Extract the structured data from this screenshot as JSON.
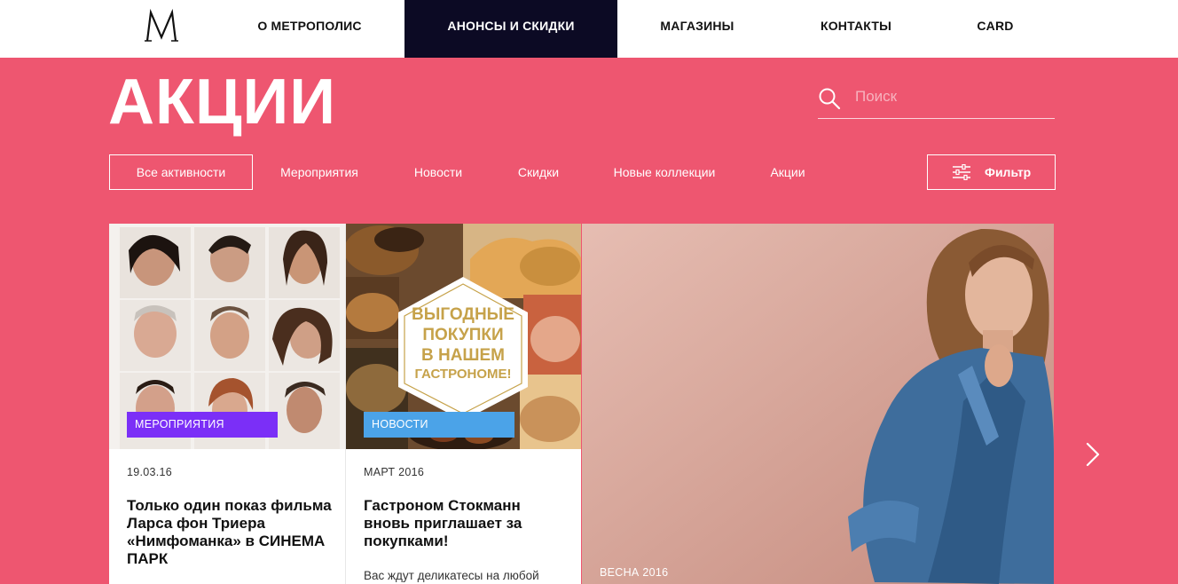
{
  "nav": {
    "items": [
      {
        "label": "О МЕТРОПОЛИС",
        "active": false
      },
      {
        "label": "АНОНСЫ И СКИДКИ",
        "active": true
      },
      {
        "label": "МАГАЗИНЫ",
        "active": false
      },
      {
        "label": "КОНТАКТЫ",
        "active": false
      },
      {
        "label": "CARD",
        "active": false
      }
    ]
  },
  "header": {
    "title": "АКЦИИ",
    "search_placeholder": "Поиск"
  },
  "tabs": [
    {
      "label": "Все активности",
      "selected": true
    },
    {
      "label": "Мероприятия",
      "selected": false
    },
    {
      "label": "Новости",
      "selected": false
    },
    {
      "label": "Скидки",
      "selected": false
    },
    {
      "label": "Новые коллекции",
      "selected": false
    },
    {
      "label": "Акции",
      "selected": false
    }
  ],
  "filter_label": "Фильтр",
  "cards": [
    {
      "badge": "МЕРОПРИЯТИЯ",
      "badge_color": "#7b2ff7",
      "date": "19.03.16",
      "title": "Только один показ фильма Ларса фон Триера «Нимфоманка» в СИНЕМА ПАРК",
      "description": ""
    },
    {
      "badge": "НОВОСТИ",
      "badge_color": "#4ba3e8",
      "date": "МАРТ 2016",
      "title": "Гастроном Стокманн вновь приглашает за покупками!",
      "description": "Вас ждут деликатесы на любой",
      "image_text": [
        "ВЫГОДНЫЕ",
        "ПОКУПКИ",
        "В НАШЕМ",
        "ГАСТРОНОМЕ!"
      ]
    }
  ],
  "hero": {
    "caption": "ВЕСНА 2016"
  },
  "colors": {
    "background": "#ee5670",
    "nav_active": "#0c0a24",
    "gold": "#c6a24a"
  },
  "icons": [
    "logo-m",
    "search-icon",
    "filter-icon",
    "chevron-right-icon"
  ]
}
